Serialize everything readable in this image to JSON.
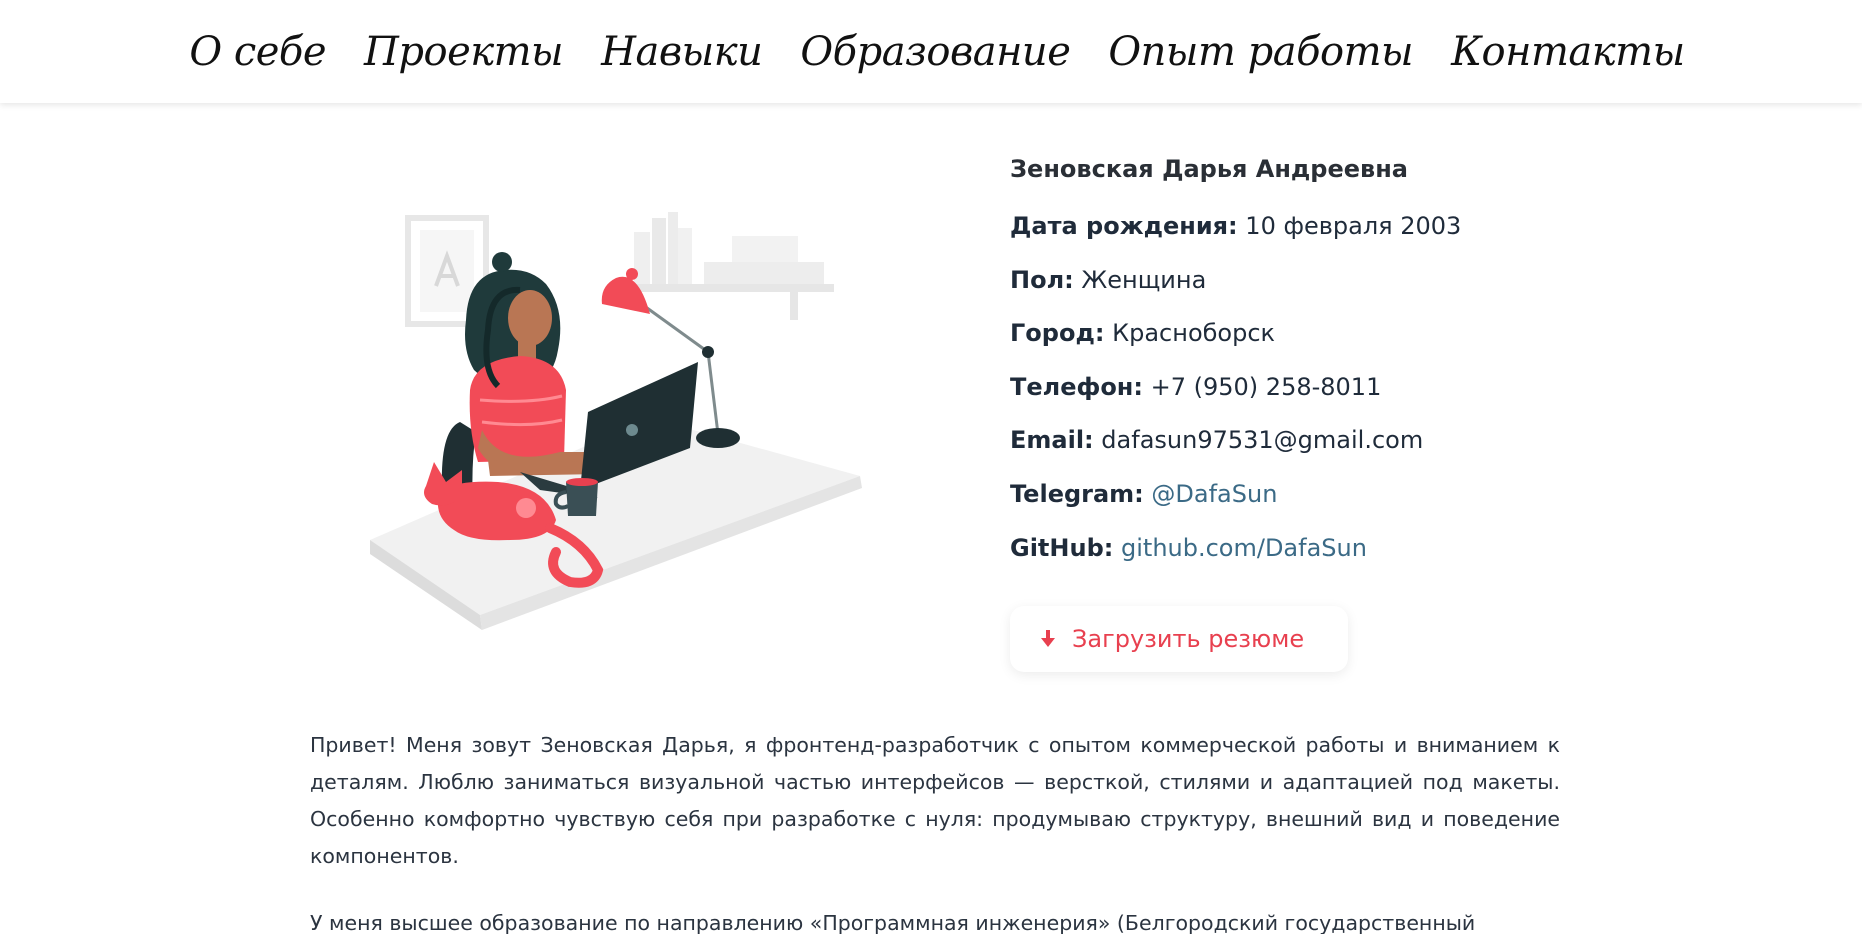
{
  "nav": {
    "items": [
      "О себе",
      "Проекты",
      "Навыки",
      "Образование",
      "Опыт работы",
      "Контакты"
    ]
  },
  "profile": {
    "name": "Зеновская Дарья Андреевна",
    "birth_label": "Дата рождения:",
    "birth_value": "10 февраля 2003",
    "gender_label": "Пол:",
    "gender_value": "Женщина",
    "city_label": "Город:",
    "city_value": "Красноборск",
    "phone_label": "Телефон:",
    "phone_value": "+7 (950) 258-8011",
    "email_label": "Email:",
    "email_value": "dafasun97531@gmail.com",
    "telegram_label": "Telegram:",
    "telegram_value": "@DafaSun",
    "github_label": "GitHub:",
    "github_value": "github.com/DafaSun"
  },
  "download": {
    "label": "Загрузить резюме",
    "icon": "arrow-down-icon"
  },
  "about": {
    "paragraph1": "Привет! Меня зовут Зеновская Дарья, я фронтенд-разработчик с опытом коммерческой работы и вниманием к деталям. Люблю заниматься визуальной частью интерфейсов — версткой, стилями и адаптацией под макеты. Особенно комфортно чувствую себя при разработке с нуля: продумываю структуру, внешний вид и поведение компонентов.",
    "paragraph2": "У меня высшее образование по направлению «Программная инженерия» (Белгородский государственный"
  },
  "colors": {
    "accent": "#e8404f",
    "link": "#3b6a86",
    "text": "#1f2b3a"
  }
}
